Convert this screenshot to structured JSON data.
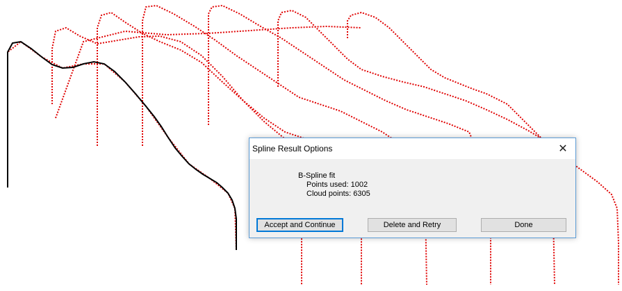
{
  "dialog": {
    "title": "Spline Result Options",
    "close_glyph": "✕",
    "fit_label": "B-Spline fit",
    "points_used": "Points used: 1002",
    "cloud_points": "Cloud points: 6305",
    "buttons": {
      "accept": "Accept and Continue",
      "retry": "Delete and Retry",
      "done": "Done"
    }
  },
  "colors": {
    "point_cloud": "#e00000",
    "fitted_spline": "#000000",
    "dialog_border": "#5b9bd5",
    "primary_button_border": "#0078d7"
  },
  "icons": {
    "close": "close-icon"
  }
}
